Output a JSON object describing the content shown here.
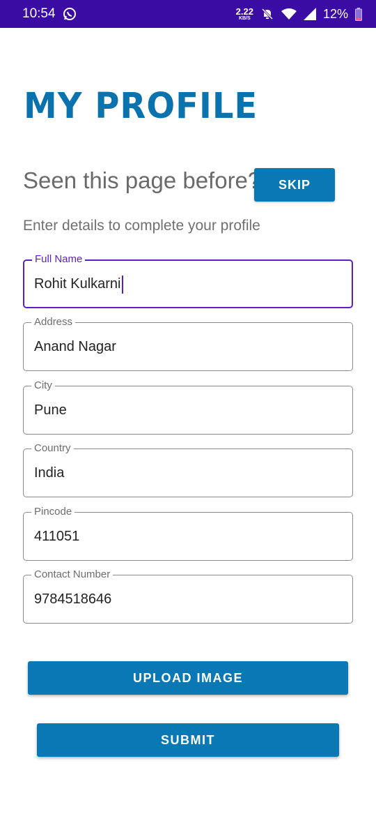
{
  "status_bar": {
    "time": "10:54",
    "net_speed_value": "2.22",
    "net_speed_unit": "KB/S",
    "battery": "12%",
    "icons": [
      "whatsapp-icon",
      "mute-bell-icon",
      "wifi-icon",
      "signal-icon",
      "battery-icon"
    ]
  },
  "header": {
    "title": "MY PROFILE"
  },
  "prompt": {
    "text": "Seen this page before?",
    "skip_label": "SKIP"
  },
  "subtitle": "Enter details to complete your profile",
  "fields": [
    {
      "label": "Full Name",
      "value": "Rohit Kulkarni",
      "focused": true
    },
    {
      "label": "Address",
      "value": "Anand Nagar"
    },
    {
      "label": "City",
      "value": "Pune"
    },
    {
      "label": "Country",
      "value": "India"
    },
    {
      "label": "Pincode",
      "value": "411051"
    },
    {
      "label": "Contact Number",
      "value": "9784518646"
    }
  ],
  "actions": {
    "upload_label": "UPLOAD IMAGE",
    "submit_label": "SUBMIT"
  },
  "colors": {
    "status_bar": "#3a0ca3",
    "accent": "#0a78b4",
    "title": "#0a72ad",
    "focus": "#5b1fc9"
  }
}
